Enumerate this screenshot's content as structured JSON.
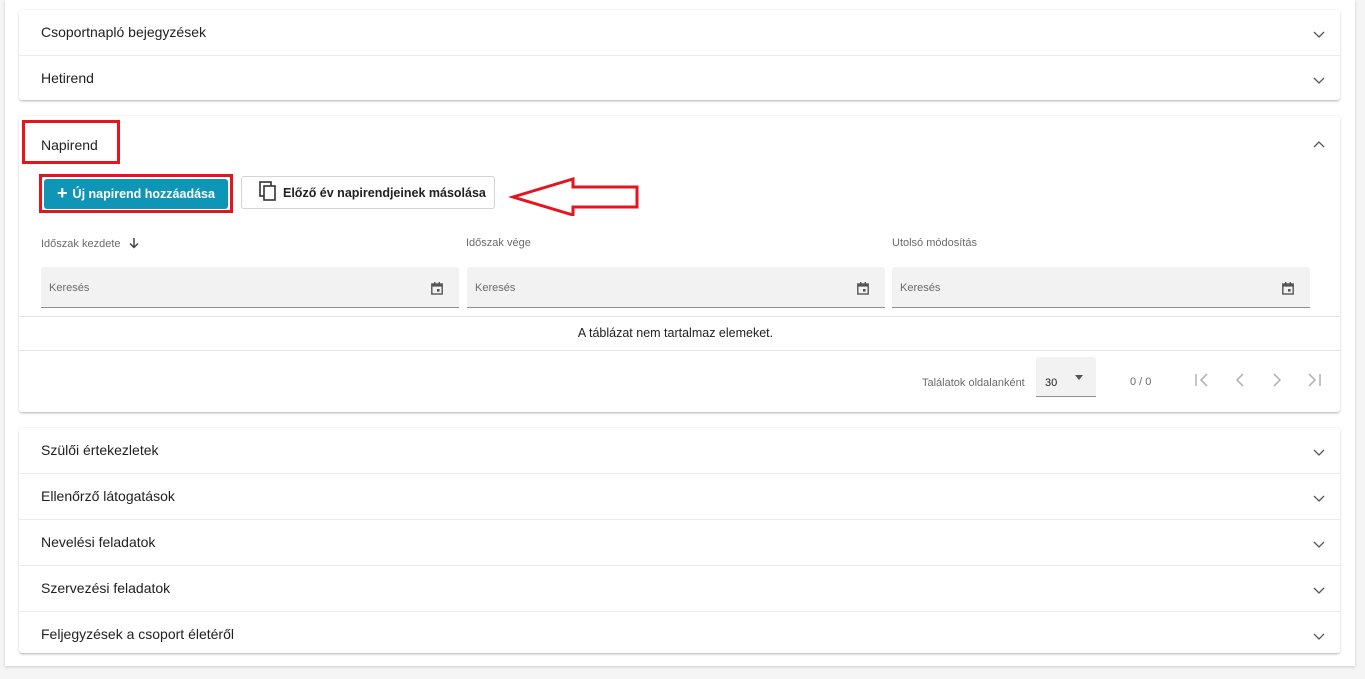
{
  "sections_top": [
    {
      "label": "Csoportnapló bejegyzések"
    },
    {
      "label": "Hetirend"
    }
  ],
  "napirend": {
    "title": "Napirend",
    "add_button": "Új napirend hozzáadása",
    "copy_button": "Előző év napirendjeinek másolása",
    "columns": [
      {
        "header": "Időszak kezdete",
        "sortable": true,
        "search_placeholder": "Keresés"
      },
      {
        "header": "Időszak vége",
        "sortable": false,
        "search_placeholder": "Keresés"
      },
      {
        "header": "Utolsó módosítás",
        "sortable": false,
        "search_placeholder": "Keresés"
      }
    ],
    "empty_message": "A táblázat nem tartalmaz elemeket.",
    "pagination": {
      "page_size_label": "Találatok oldalanként",
      "page_size": "30",
      "range": "0 / 0"
    }
  },
  "sections_bottom": [
    {
      "label": "Szülői értekezletek"
    },
    {
      "label": "Ellenőrző látogatások"
    },
    {
      "label": "Nevelési feladatok"
    },
    {
      "label": "Szervezési feladatok"
    },
    {
      "label": "Feljegyzések a csoport életéről"
    }
  ],
  "colors": {
    "primary_button": "#0f96b6",
    "annotation_red": "#e4151d"
  },
  "icons": [
    "chevron-down-icon",
    "chevron-up-icon",
    "plus-icon",
    "copy-icon",
    "arrow-down-icon",
    "calendar-icon",
    "first-page-icon",
    "prev-page-icon",
    "next-page-icon",
    "last-page-icon"
  ]
}
